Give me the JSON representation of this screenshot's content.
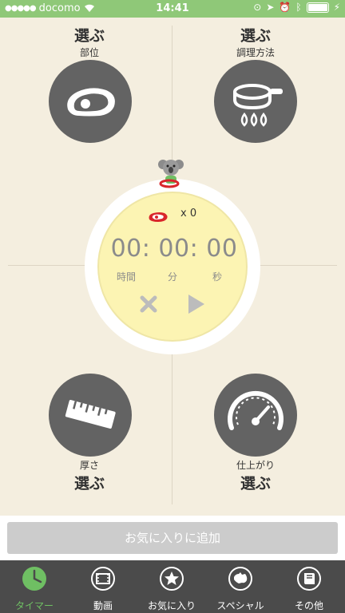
{
  "status_bar": {
    "carrier": "docomo",
    "time": "14:41"
  },
  "quadrants": {
    "top_left": {
      "action": "選ぶ",
      "label": "部位"
    },
    "top_right": {
      "action": "選ぶ",
      "label": "調理方法"
    },
    "bottom_left": {
      "label": "厚さ",
      "action": "選ぶ"
    },
    "bottom_right": {
      "label": "仕上がり",
      "action": "選ぶ"
    }
  },
  "timer": {
    "count": "x 0",
    "display": "00: 00: 00",
    "units": {
      "hours": "時間",
      "minutes": "分",
      "seconds": "秒"
    }
  },
  "favorite_button": {
    "label": "お気に入りに追加"
  },
  "tabs": [
    {
      "label": "タイマー",
      "icon": "clock-icon",
      "active": true
    },
    {
      "label": "動画",
      "icon": "film-icon",
      "active": false
    },
    {
      "label": "お気に入り",
      "icon": "star-icon",
      "active": false
    },
    {
      "label": "スペシャル",
      "icon": "australia-icon",
      "active": false
    },
    {
      "label": "その他",
      "icon": "book-icon",
      "active": false
    }
  ],
  "colors": {
    "status_bar": "#8fc878",
    "background": "#f4eedf",
    "circle": "#636363",
    "timer_face": "#fcf4b3",
    "tab_bar": "#4b4b4b",
    "active_tab": "#6fbf63"
  }
}
